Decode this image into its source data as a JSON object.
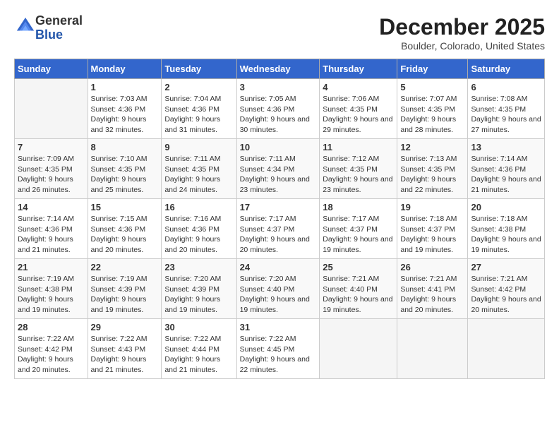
{
  "header": {
    "logo_line1": "General",
    "logo_line2": "Blue",
    "month": "December 2025",
    "location": "Boulder, Colorado, United States"
  },
  "weekdays": [
    "Sunday",
    "Monday",
    "Tuesday",
    "Wednesday",
    "Thursday",
    "Friday",
    "Saturday"
  ],
  "weeks": [
    [
      {
        "day": "",
        "sunrise": "",
        "sunset": "",
        "daylight": ""
      },
      {
        "day": "1",
        "sunrise": "7:03 AM",
        "sunset": "4:36 PM",
        "daylight": "9 hours and 32 minutes."
      },
      {
        "day": "2",
        "sunrise": "7:04 AM",
        "sunset": "4:36 PM",
        "daylight": "9 hours and 31 minutes."
      },
      {
        "day": "3",
        "sunrise": "7:05 AM",
        "sunset": "4:36 PM",
        "daylight": "9 hours and 30 minutes."
      },
      {
        "day": "4",
        "sunrise": "7:06 AM",
        "sunset": "4:35 PM",
        "daylight": "9 hours and 29 minutes."
      },
      {
        "day": "5",
        "sunrise": "7:07 AM",
        "sunset": "4:35 PM",
        "daylight": "9 hours and 28 minutes."
      },
      {
        "day": "6",
        "sunrise": "7:08 AM",
        "sunset": "4:35 PM",
        "daylight": "9 hours and 27 minutes."
      }
    ],
    [
      {
        "day": "7",
        "sunrise": "7:09 AM",
        "sunset": "4:35 PM",
        "daylight": "9 hours and 26 minutes."
      },
      {
        "day": "8",
        "sunrise": "7:10 AM",
        "sunset": "4:35 PM",
        "daylight": "9 hours and 25 minutes."
      },
      {
        "day": "9",
        "sunrise": "7:11 AM",
        "sunset": "4:35 PM",
        "daylight": "9 hours and 24 minutes."
      },
      {
        "day": "10",
        "sunrise": "7:11 AM",
        "sunset": "4:34 PM",
        "daylight": "9 hours and 23 minutes."
      },
      {
        "day": "11",
        "sunrise": "7:12 AM",
        "sunset": "4:35 PM",
        "daylight": "9 hours and 23 minutes."
      },
      {
        "day": "12",
        "sunrise": "7:13 AM",
        "sunset": "4:35 PM",
        "daylight": "9 hours and 22 minutes."
      },
      {
        "day": "13",
        "sunrise": "7:14 AM",
        "sunset": "4:36 PM",
        "daylight": "9 hours and 21 minutes."
      }
    ],
    [
      {
        "day": "14",
        "sunrise": "7:14 AM",
        "sunset": "4:36 PM",
        "daylight": "9 hours and 21 minutes."
      },
      {
        "day": "15",
        "sunrise": "7:15 AM",
        "sunset": "4:36 PM",
        "daylight": "9 hours and 20 minutes."
      },
      {
        "day": "16",
        "sunrise": "7:16 AM",
        "sunset": "4:36 PM",
        "daylight": "9 hours and 20 minutes."
      },
      {
        "day": "17",
        "sunrise": "7:17 AM",
        "sunset": "4:37 PM",
        "daylight": "9 hours and 20 minutes."
      },
      {
        "day": "18",
        "sunrise": "7:17 AM",
        "sunset": "4:37 PM",
        "daylight": "9 hours and 19 minutes."
      },
      {
        "day": "19",
        "sunrise": "7:18 AM",
        "sunset": "4:37 PM",
        "daylight": "9 hours and 19 minutes."
      },
      {
        "day": "20",
        "sunrise": "7:18 AM",
        "sunset": "4:38 PM",
        "daylight": "9 hours and 19 minutes."
      }
    ],
    [
      {
        "day": "21",
        "sunrise": "7:19 AM",
        "sunset": "4:38 PM",
        "daylight": "9 hours and 19 minutes."
      },
      {
        "day": "22",
        "sunrise": "7:19 AM",
        "sunset": "4:39 PM",
        "daylight": "9 hours and 19 minutes."
      },
      {
        "day": "23",
        "sunrise": "7:20 AM",
        "sunset": "4:39 PM",
        "daylight": "9 hours and 19 minutes."
      },
      {
        "day": "24",
        "sunrise": "7:20 AM",
        "sunset": "4:40 PM",
        "daylight": "9 hours and 19 minutes."
      },
      {
        "day": "25",
        "sunrise": "7:21 AM",
        "sunset": "4:40 PM",
        "daylight": "9 hours and 19 minutes."
      },
      {
        "day": "26",
        "sunrise": "7:21 AM",
        "sunset": "4:41 PM",
        "daylight": "9 hours and 20 minutes."
      },
      {
        "day": "27",
        "sunrise": "7:21 AM",
        "sunset": "4:42 PM",
        "daylight": "9 hours and 20 minutes."
      }
    ],
    [
      {
        "day": "28",
        "sunrise": "7:22 AM",
        "sunset": "4:42 PM",
        "daylight": "9 hours and 20 minutes."
      },
      {
        "day": "29",
        "sunrise": "7:22 AM",
        "sunset": "4:43 PM",
        "daylight": "9 hours and 21 minutes."
      },
      {
        "day": "30",
        "sunrise": "7:22 AM",
        "sunset": "4:44 PM",
        "daylight": "9 hours and 21 minutes."
      },
      {
        "day": "31",
        "sunrise": "7:22 AM",
        "sunset": "4:45 PM",
        "daylight": "9 hours and 22 minutes."
      },
      {
        "day": "",
        "sunrise": "",
        "sunset": "",
        "daylight": ""
      },
      {
        "day": "",
        "sunrise": "",
        "sunset": "",
        "daylight": ""
      },
      {
        "day": "",
        "sunrise": "",
        "sunset": "",
        "daylight": ""
      }
    ]
  ],
  "labels": {
    "sunrise_prefix": "Sunrise: ",
    "sunset_prefix": "Sunset: ",
    "daylight_prefix": "Daylight: "
  }
}
